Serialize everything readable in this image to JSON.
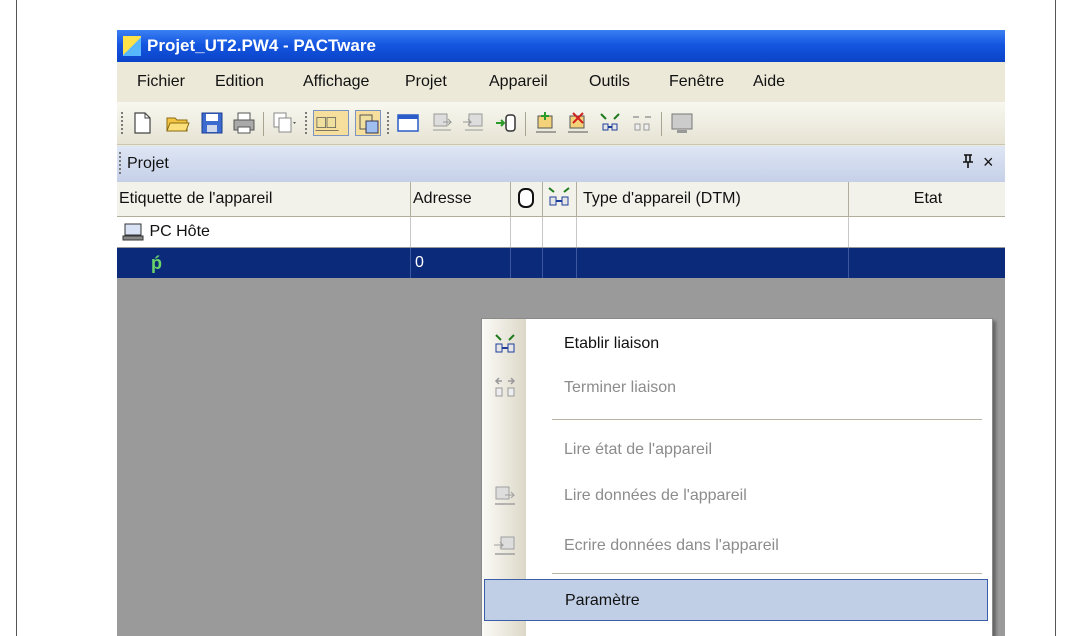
{
  "window": {
    "title": "Projet_UT2.PW4 - PACTware"
  },
  "menu": [
    "Fichier",
    "Edition",
    "Affichage",
    "Projet",
    "Appareil",
    "Outils",
    "Fenêtre",
    "Aide"
  ],
  "toolbar": {
    "icons": [
      "new-document-icon",
      "open-folder-icon",
      "save-icon",
      "print-icon",
      "copy-dropdown-icon",
      "project-view-icon",
      "catalog-view-icon",
      "window-icon",
      "read-device-icon",
      "write-device-icon",
      "connect-device-icon",
      "add-device-icon",
      "delete-device-icon",
      "connect-icon",
      "disconnect-icon",
      "screen-icon"
    ]
  },
  "panel": {
    "title": "Projet",
    "pin": "ꟼ",
    "close": "×"
  },
  "table": {
    "columns": [
      "Etiquette de l'appareil",
      "Adresse",
      "",
      "",
      "Type d'appareil (DTM)",
      "Etat"
    ],
    "rows": [
      {
        "label": "PC Hôte",
        "address": "",
        "type": "",
        "state": ""
      },
      {
        "label": "",
        "address": "0",
        "type": "",
        "state": ""
      }
    ]
  },
  "context_menu": {
    "items": [
      {
        "label": "Etablir liaison",
        "enabled": true,
        "icon": "connect-icon"
      },
      {
        "label": "Terminer liaison",
        "enabled": false,
        "icon": "disconnect-icon"
      },
      {
        "label": "Lire état de l'appareil",
        "enabled": false,
        "icon": ""
      },
      {
        "label": "Lire données de l'appareil",
        "enabled": false,
        "icon": "read-device-icon"
      },
      {
        "label": "Ecrire données dans l'appareil",
        "enabled": false,
        "icon": "write-device-icon"
      },
      {
        "label": "Paramètre",
        "enabled": true,
        "icon": "",
        "highlighted": true
      }
    ]
  },
  "colors": {
    "titlebar": "#0a43c8",
    "selection": "#0c2a7a",
    "hover": "#c0cee6"
  }
}
